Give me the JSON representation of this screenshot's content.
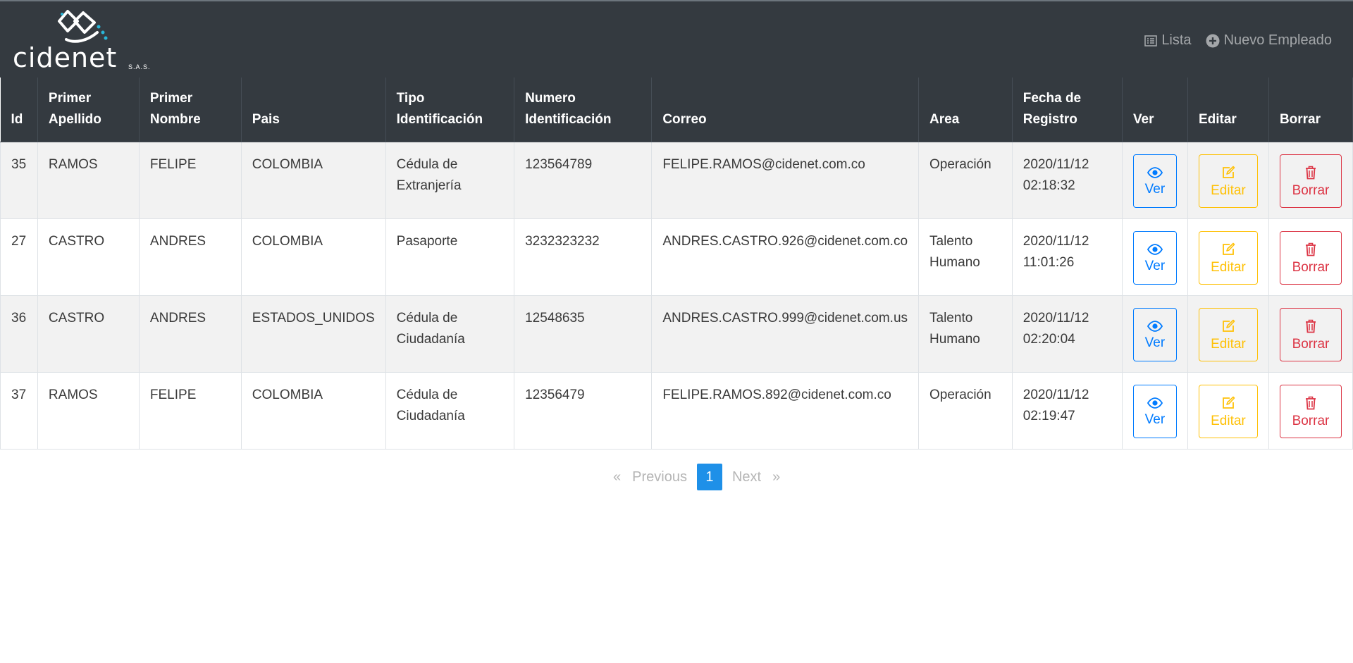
{
  "brand": {
    "name": "cidenet",
    "suffix": "S.A.S."
  },
  "nav": {
    "list_label": "Lista",
    "new_label": "Nuevo Empleado"
  },
  "table": {
    "headers": [
      "Id",
      "Primer Apellido",
      "Primer Nombre",
      "Pais",
      "Tipo Identificación",
      "Numero Identificación",
      "Correo",
      "Area",
      "Fecha de Registro",
      "Ver",
      "Editar",
      "Borrar"
    ],
    "rows": [
      {
        "id": "35",
        "apellido": "RAMOS",
        "nombre": "FELIPE",
        "pais": "COLOMBIA",
        "tipo": "Cédula de Extranjería",
        "numero": "123564789",
        "correo": "FELIPE.RAMOS@cidenet.com.co",
        "area": "Operación",
        "fecha": "2020/11/12 02:18:32"
      },
      {
        "id": "27",
        "apellido": "CASTRO",
        "nombre": "ANDRES",
        "pais": "COLOMBIA",
        "tipo": "Pasaporte",
        "numero": "3232323232",
        "correo": "ANDRES.CASTRO.926@cidenet.com.co",
        "area": "Talento Humano",
        "fecha": "2020/11/12 11:01:26"
      },
      {
        "id": "36",
        "apellido": "CASTRO",
        "nombre": "ANDRES",
        "pais": "ESTADOS_UNIDOS",
        "tipo": "Cédula de Ciudadanía",
        "numero": "12548635",
        "correo": "ANDRES.CASTRO.999@cidenet.com.us",
        "area": "Talento Humano",
        "fecha": "2020/11/12 02:20:04"
      },
      {
        "id": "37",
        "apellido": "RAMOS",
        "nombre": "FELIPE",
        "pais": "COLOMBIA",
        "tipo": "Cédula de Ciudadanía",
        "numero": "12356479",
        "correo": "FELIPE.RAMOS.892@cidenet.com.co",
        "area": "Operación",
        "fecha": "2020/11/12 02:19:47"
      }
    ],
    "actions": {
      "view": "Ver",
      "edit": "Editar",
      "delete": "Borrar"
    }
  },
  "pagination": {
    "first": "«",
    "previous": "Previous",
    "current": "1",
    "next": "Next",
    "last": "»"
  },
  "colors": {
    "navbar": "#343a40",
    "view": "#007bff",
    "edit": "#ffc107",
    "delete": "#dc3545",
    "page_active": "#1e90e8"
  },
  "icons": {
    "nav_list": "list-icon",
    "nav_new": "plus-circle-icon",
    "view": "eye-icon",
    "edit": "edit-icon",
    "delete": "trash-icon"
  }
}
